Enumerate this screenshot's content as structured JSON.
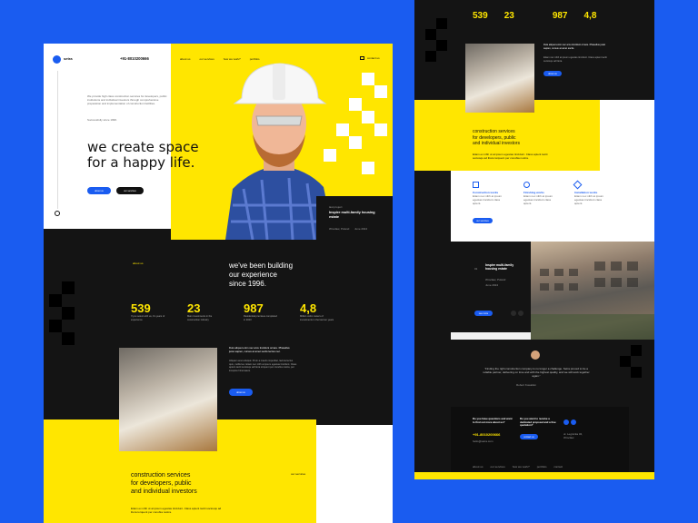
{
  "brand": {
    "logo_letter": "S",
    "name": "setra",
    "phone": "+91-8010200666"
  },
  "nav": {
    "items": [
      "about us",
      "our services",
      "how we work?",
      "portfolio"
    ],
    "contact": "contact us"
  },
  "hero": {
    "intro": "We provide high class construction services for developers, public institutions and individual investors through comprehensive preparation and implementation of construction facilities.",
    "since": "Successfully since 1996.",
    "headline_line1": "we create space",
    "headline_line2": "for a happy life.",
    "btn_primary": "about us",
    "btn_secondary": "our services"
  },
  "last_project": {
    "tag": "last project",
    "title": "Inspire multi-family housing estate",
    "location": "Wrocław, Poland",
    "date": "June 2024"
  },
  "about": {
    "tag": "about us",
    "title_line1": "we've been building",
    "title_line2": "our experience",
    "title_line3": "since 1996."
  },
  "stats": [
    {
      "value": "539",
      "label": "If you select with us, it's years of experience"
    },
    {
      "value": "23",
      "label": "Main investments in the construction industry"
    },
    {
      "value": "987",
      "label": "Residential premises completed in 2023"
    },
    {
      "value": "4,8",
      "label": "Million cubic meters of investments in the last ten years"
    }
  ],
  "mission": {
    "lead": "Duis aliquet enim nec arcu tincidunt ornare. Phasellus justo sapien, cursus at amet sociis lectus nec.",
    "body": "Aliquam erat volutpat. Proin a mauris imperdiet, lacinia lectus quis, mollis leo. Etiam nec nibh at ipsum egestas tincidunt. Class aptent taciti sociosqu ad litora torquent per conubia nostra, per inceptos himenaeos.",
    "btn": "about us"
  },
  "services": {
    "title_line1": "construction services",
    "title_line2": "for developers, public",
    "title_line3": "and individual investors",
    "tag": "our services",
    "body": "Etiam ex nibh ut at ipsum egestas tincidunt. Class aptent taciti sociosqu ad litora torquent per conubia nostra."
  },
  "right": {
    "mission_lead": "Duis aliquet enim nec arcu tincidunt ornare. Phasellus justo sapien, cursus at amet sociis.",
    "mission_body": "Etiam nec nibh at ipsum egestas tincidunt. Class aptent taciti sociosqu ad litora.",
    "mission_btn": "about us",
    "features": [
      {
        "title": "Construction works",
        "body": "Etiam nec nibh at ipsum egestas tincidunt class aptent."
      },
      {
        "title": "Finishing works",
        "body": "Etiam nec nibh at ipsum egestas tincidunt class aptent."
      },
      {
        "title": "Installation works",
        "body": "Etiam nec nibh at ipsum egestas tincidunt class aptent."
      }
    ],
    "features_btn": "our services",
    "project_num": "01",
    "project_title": "Inspire multi-family housing estate",
    "project_meta": "Wrocław, Poland",
    "project_date": "June 2024",
    "project_btn": "see more",
    "testimonial": "“Finding the right construction company is no longer a challenge. Setra proved to be a reliable partner, delivering on time and with the highest quality, and we will work together again.”",
    "testimonial_author": "Robert Kowalski",
    "contact_q": "Do you have questions and want to find out more about us?",
    "contact_phone": "+91-8010200666",
    "contact_email": "hello@setra.com",
    "contact_offer": "Do you want to receive a dedicated proposal and a free quotation?",
    "contact_btn": "contact us",
    "address": "ul. Legnicka 32, Wrocław",
    "footer_links": [
      "about us",
      "our services",
      "how we work?",
      "portfolio",
      "contact"
    ]
  },
  "colors": {
    "accent": "#1a5cf0",
    "brand_yellow": "#ffe600",
    "dark": "#141414"
  }
}
